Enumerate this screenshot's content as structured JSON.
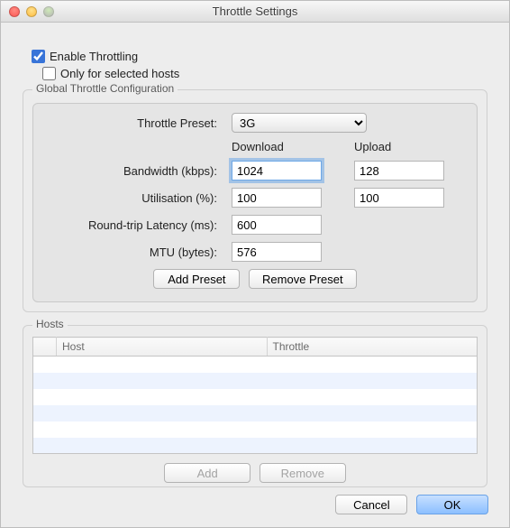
{
  "window": {
    "title": "Throttle Settings"
  },
  "enable": {
    "label": "Enable Throttling",
    "checked": true
  },
  "only_selected": {
    "label": "Only for selected hosts",
    "checked": false
  },
  "group_global": {
    "legend": "Global Throttle Configuration"
  },
  "form": {
    "preset_label": "Throttle Preset:",
    "preset_value": "3G",
    "download_header": "Download",
    "upload_header": "Upload",
    "bandwidth_label": "Bandwidth (kbps):",
    "bandwidth_dl": "1024",
    "bandwidth_ul": "128",
    "util_label": "Utilisation (%):",
    "util_dl": "100",
    "util_ul": "100",
    "rtt_label": "Round-trip Latency (ms):",
    "rtt_val": "600",
    "mtu_label": "MTU (bytes):",
    "mtu_val": "576"
  },
  "buttons": {
    "add_preset": "Add Preset",
    "remove_preset": "Remove Preset",
    "add": "Add",
    "remove": "Remove",
    "cancel": "Cancel",
    "ok": "OK"
  },
  "group_hosts": {
    "legend": "Hosts"
  },
  "hosts_table": {
    "col_host": "Host",
    "col_throttle": "Throttle"
  }
}
